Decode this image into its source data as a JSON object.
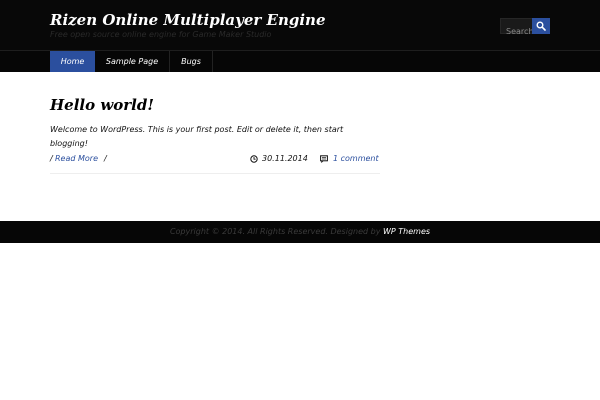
{
  "site": {
    "title": "Rizen Online Multiplayer Engine",
    "description": "Free open source online engine for Game Maker Studio"
  },
  "search": {
    "placeholder": "Search",
    "button_icon": "search-icon"
  },
  "nav": {
    "items": [
      {
        "label": "Home",
        "active": true
      },
      {
        "label": "Sample Page",
        "active": false
      },
      {
        "label": "Bugs",
        "active": false
      }
    ]
  },
  "post": {
    "title": "Hello world!",
    "excerpt": "Welcome to WordPress. This is your first post. Edit or delete it, then start blogging!",
    "meta_prefix": "/",
    "read_more": "Read More",
    "meta_suffix": "/",
    "date": "30.11.2014",
    "comments": "1 comment",
    "date_icon": "clock-icon",
    "comments_icon": "comment-icon"
  },
  "footer": {
    "text": "Copyright © 2014. All Rights Reserved. Designed by ",
    "link_label": "WP Themes"
  },
  "colors": {
    "accent": "#2b4f9e",
    "header_bg": "#080808",
    "footer_bg": "#060606"
  }
}
